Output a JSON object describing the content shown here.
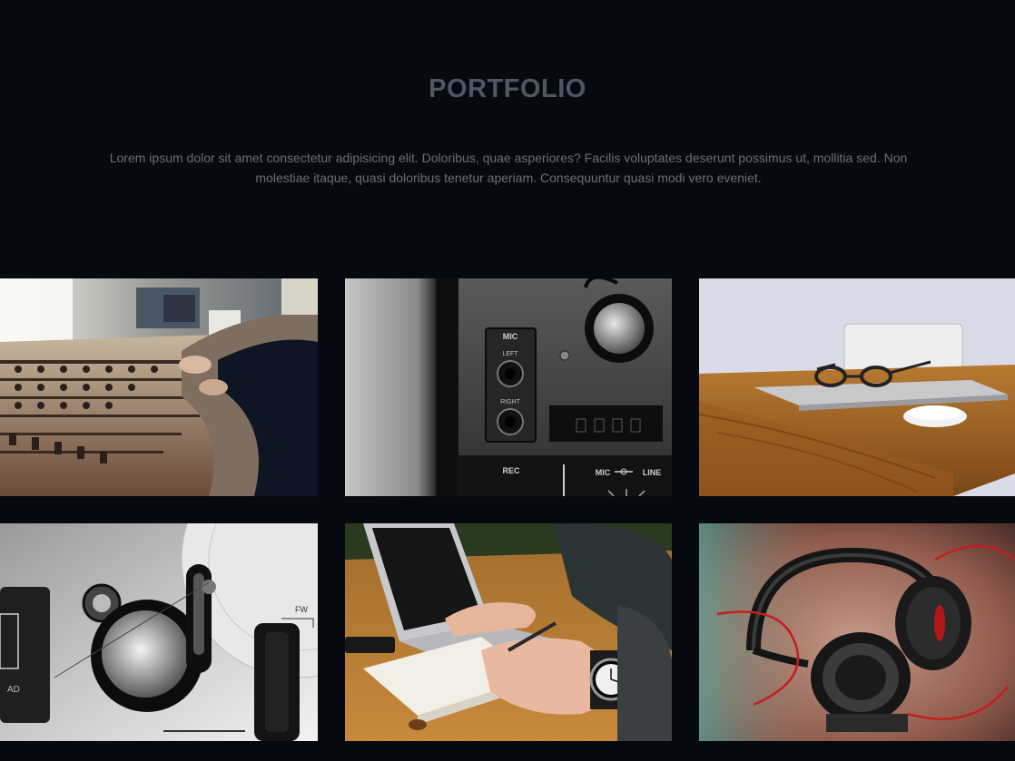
{
  "portfolio": {
    "title": "PORTFOLIO",
    "description": "Lorem ipsum dolor sit amet consectetur adipisicing elit. Doloribus, quae asperiores? Facilis voluptates deserunt possimus ut, mollitia sed. Non molestiae itaque, quasi doloribus tenetur aperiam. Consequuntur quasi modi vero eveniet."
  },
  "gallery": {
    "items": [
      {
        "subject": "mixing-console"
      },
      {
        "subject": "tape-recorder-panel",
        "labels": {
          "mic": "MIC",
          "left": "LEFT",
          "right": "RIGHT",
          "rec": "REC",
          "mic_line": "MIC",
          "line": "LINE"
        }
      },
      {
        "subject": "glasses-laptop-desk"
      },
      {
        "subject": "turntable-knob",
        "labels": {
          "fw": "FW",
          "ad": "AD"
        }
      },
      {
        "subject": "writing-notebook"
      },
      {
        "subject": "headphones"
      }
    ]
  },
  "colors": {
    "background": "#060910",
    "title": "#4d5863",
    "text": "#6b6f74"
  }
}
